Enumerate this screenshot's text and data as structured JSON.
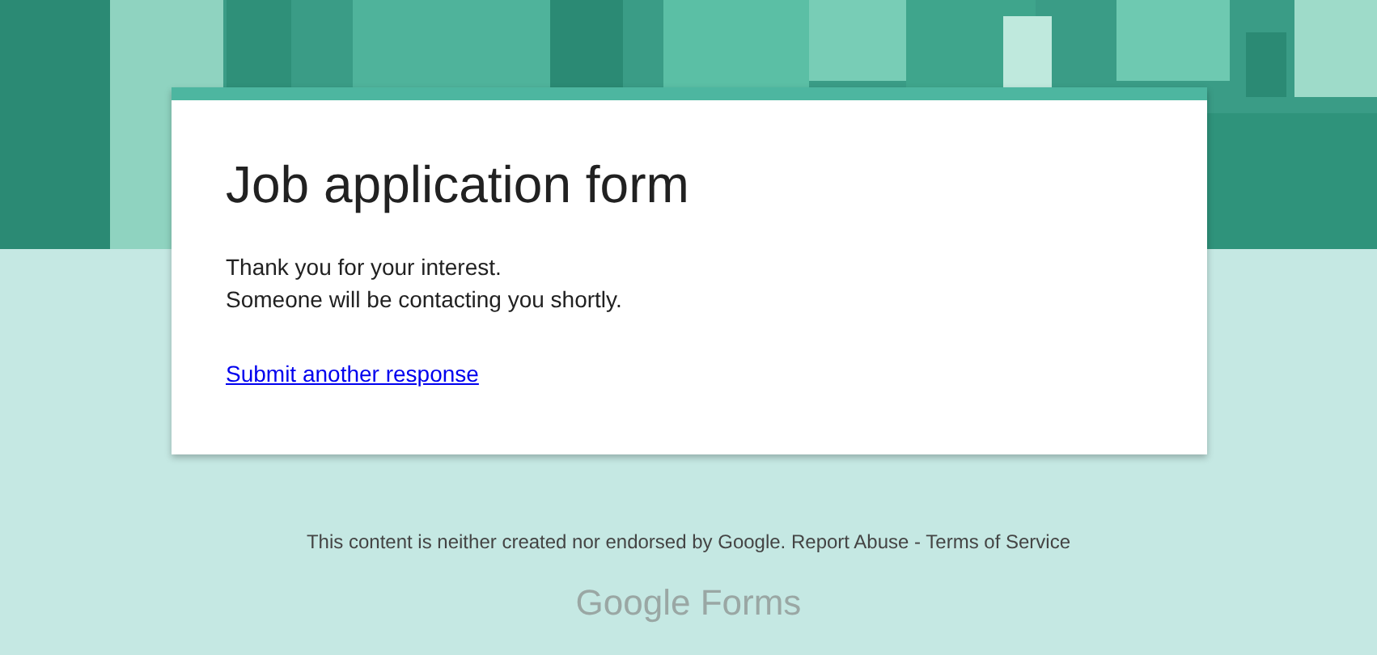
{
  "card": {
    "title": "Job application form",
    "message": [
      "Thank you for your interest.",
      "Someone will be contacting you shortly."
    ],
    "link": "Submit another response"
  },
  "footer": {
    "disclaimer": "This content is neither created nor endorsed by Google.",
    "links": [
      "Report Abuse",
      "Terms of Service"
    ],
    "separator": "-"
  },
  "logo": {
    "brand": "Google",
    "product": "Forms"
  }
}
